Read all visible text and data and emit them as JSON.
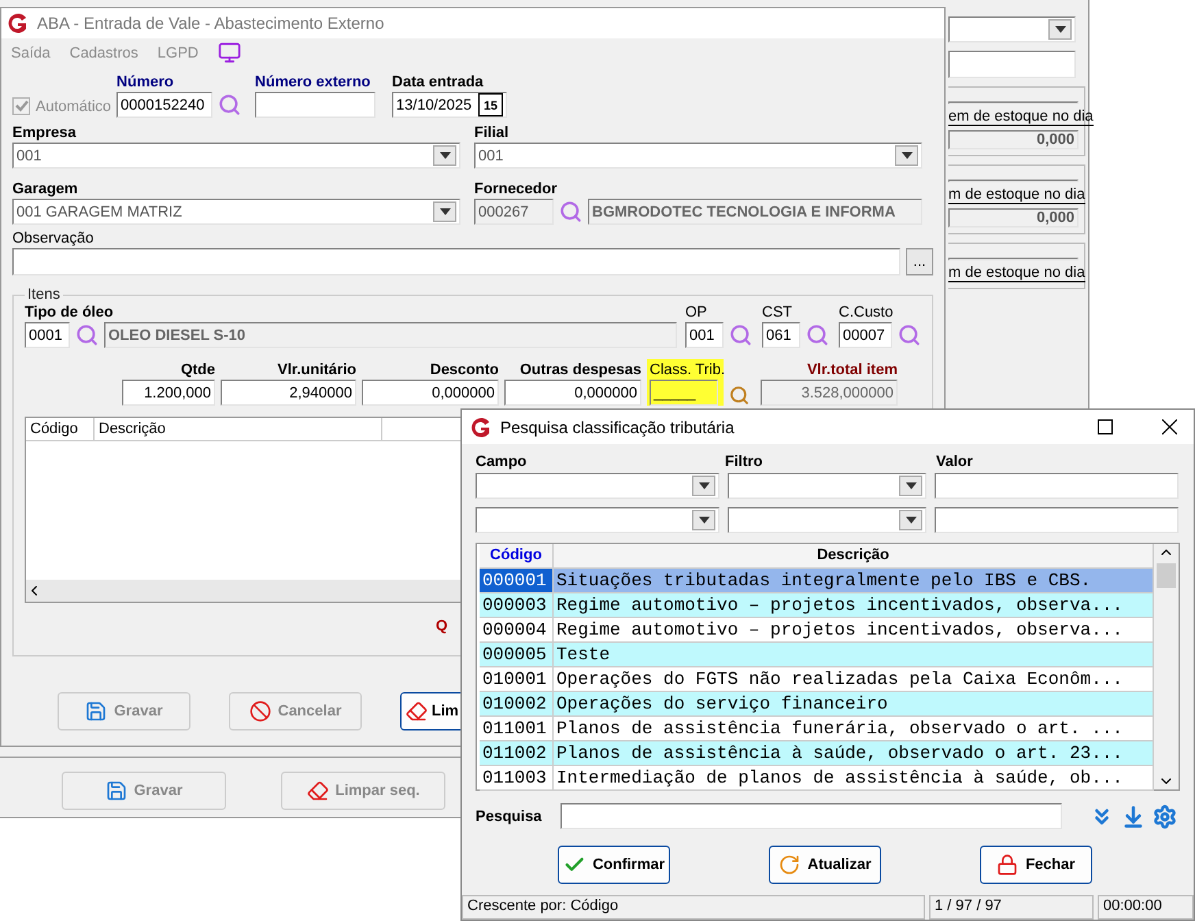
{
  "background_window": {
    "panels": [
      {
        "label": "em de estoque no dia",
        "value": "0,000"
      },
      {
        "label": "m de estoque no dia",
        "value": "0,000"
      },
      {
        "label": "m de estoque no dia"
      }
    ],
    "buttons": [
      {
        "label": "Gravar",
        "kind": "save",
        "disabled": true
      },
      {
        "label": "Limpar seq.",
        "kind": "clear",
        "disabled": true
      }
    ]
  },
  "main_window": {
    "title": "ABA - Entrada de Vale - Abastecimento Externo",
    "menu": [
      "Saída",
      "Cadastros",
      "LGPD"
    ],
    "automatico": {
      "label": "Automático",
      "checked": true,
      "disabled": true
    },
    "numero": {
      "label": "Número",
      "value": "0000152240"
    },
    "numero_externo": {
      "label": "Número externo"
    },
    "data_entrada": {
      "label": "Data entrada",
      "value": "13/10/2025",
      "button": "15"
    },
    "empresa": {
      "label": "Empresa",
      "value": "001"
    },
    "filial": {
      "label": "Filial",
      "value": "001"
    },
    "garagem": {
      "label": "Garagem",
      "value": "001 GARAGEM MATRIZ"
    },
    "fornecedor": {
      "label": "Fornecedor",
      "code": "000267",
      "name": "BGMRODOTEC TECNOLOGIA E INFORMA"
    },
    "observacao": {
      "label": "Observação",
      "button": "..."
    },
    "itens": {
      "title": "Itens",
      "tipo_oleo": {
        "label": "Tipo de óleo",
        "code": "0001",
        "name": "OLEO DIESEL S-10"
      },
      "codes": [
        {
          "label": "OP",
          "value": "001"
        },
        {
          "label": "CST",
          "value": "061"
        },
        {
          "label": "C.Custo",
          "value": "00007"
        }
      ],
      "values": [
        {
          "label": "Qtde",
          "value": "1.200,000"
        },
        {
          "label": "Vlr.unitário",
          "value": "2,940000"
        },
        {
          "label": "Desconto",
          "value": "0,000000"
        },
        {
          "label": "Outras despesas",
          "value": "0,000000"
        }
      ],
      "class_trib": {
        "label": "Class. Trib.",
        "value": "_____",
        "highlighted": true
      },
      "total": {
        "label": "Vlr.total item",
        "value": "3.528,000000"
      },
      "grid": {
        "columns": [
          "Código",
          "Descrição"
        ]
      },
      "total_label": "Q"
    },
    "buttons": [
      {
        "label": "Gravar",
        "kind": "save",
        "disabled": true
      },
      {
        "label": "Cancelar",
        "kind": "cancel",
        "disabled": true
      },
      {
        "label": "Lim",
        "kind": "clear",
        "disabled": false
      }
    ]
  },
  "dialog": {
    "title": "Pesquisa classificação tributária",
    "filter_labels": [
      "Campo",
      "Filtro",
      "Valor"
    ],
    "table": {
      "columns": [
        "Código",
        "Descrição"
      ],
      "rows": [
        {
          "code": "000001",
          "description": "Situações tributadas integralmente pelo IBS e CBS.",
          "selected": true
        },
        {
          "code": "000003",
          "description": "Regime automotivo – projetos incentivados, observa...",
          "selected": false
        },
        {
          "code": "000004",
          "description": "Regime automotivo – projetos incentivados, observa...",
          "selected": false
        },
        {
          "code": "000005",
          "description": "Teste",
          "selected": false
        },
        {
          "code": "010001",
          "description": "Operações do FGTS não realizadas pela Caixa Econôm...",
          "selected": false
        },
        {
          "code": "010002",
          "description": "Operações do serviço financeiro",
          "selected": false
        },
        {
          "code": "011001",
          "description": "Planos de assistência funerária, observado o art. ...",
          "selected": false
        },
        {
          "code": "011002",
          "description": "Planos de assistência à saúde, observado o art. 23...",
          "selected": false
        },
        {
          "code": "011003",
          "description": "Intermediação de planos de assistência à saúde, ob...",
          "selected": false
        }
      ]
    },
    "search": {
      "label": "Pesquisa"
    },
    "buttons": [
      {
        "label": "Confirmar",
        "kind": "confirm"
      },
      {
        "label": "Atualizar",
        "kind": "refresh"
      },
      {
        "label": "Fechar",
        "kind": "close"
      }
    ],
    "status_bar": [
      "Crescente por: Código",
      "1 / 97 / 97",
      "00:00:00"
    ]
  }
}
